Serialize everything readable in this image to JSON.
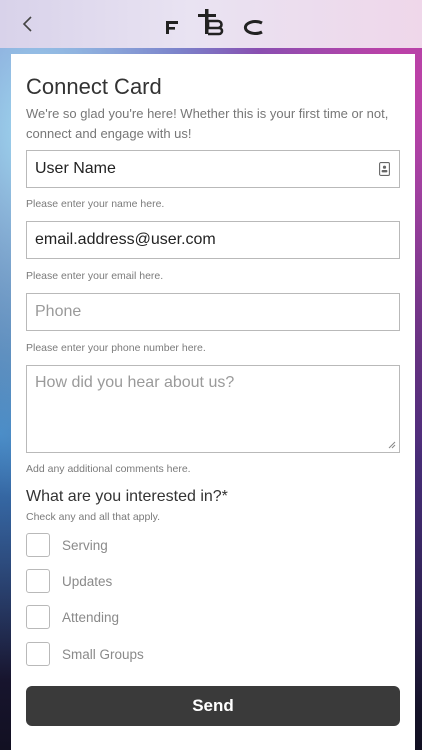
{
  "header": {
    "back_icon": "chevron-left-icon",
    "logo_text": "FBC"
  },
  "card": {
    "title": "Connect Card",
    "subtitle": "We're so glad you're here! Whether this is your first time or not, connect and engage with us!"
  },
  "fields": {
    "name": {
      "value": "User Name",
      "placeholder": "",
      "help": "Please enter your name here.",
      "icon": "contact-card-icon"
    },
    "email": {
      "value": "email.address@user.com",
      "placeholder": "",
      "help": "Please enter your email here."
    },
    "phone": {
      "value": "",
      "placeholder": "Phone",
      "help": "Please enter your phone number here."
    },
    "comments": {
      "value": "",
      "placeholder": "How did you hear about us?",
      "help": "Add any additional comments here."
    }
  },
  "interests": {
    "title": "What are you interested in?*",
    "help": "Check any and all that apply.",
    "options": [
      {
        "label": "Serving",
        "checked": false
      },
      {
        "label": "Updates",
        "checked": false
      },
      {
        "label": "Attending",
        "checked": false
      },
      {
        "label": "Small Groups",
        "checked": false
      }
    ]
  },
  "send_label": "Send",
  "colors": {
    "button_bg": "#3a3a3a",
    "field_border": "#b9b9b9",
    "help_text": "#7b7b7b"
  }
}
